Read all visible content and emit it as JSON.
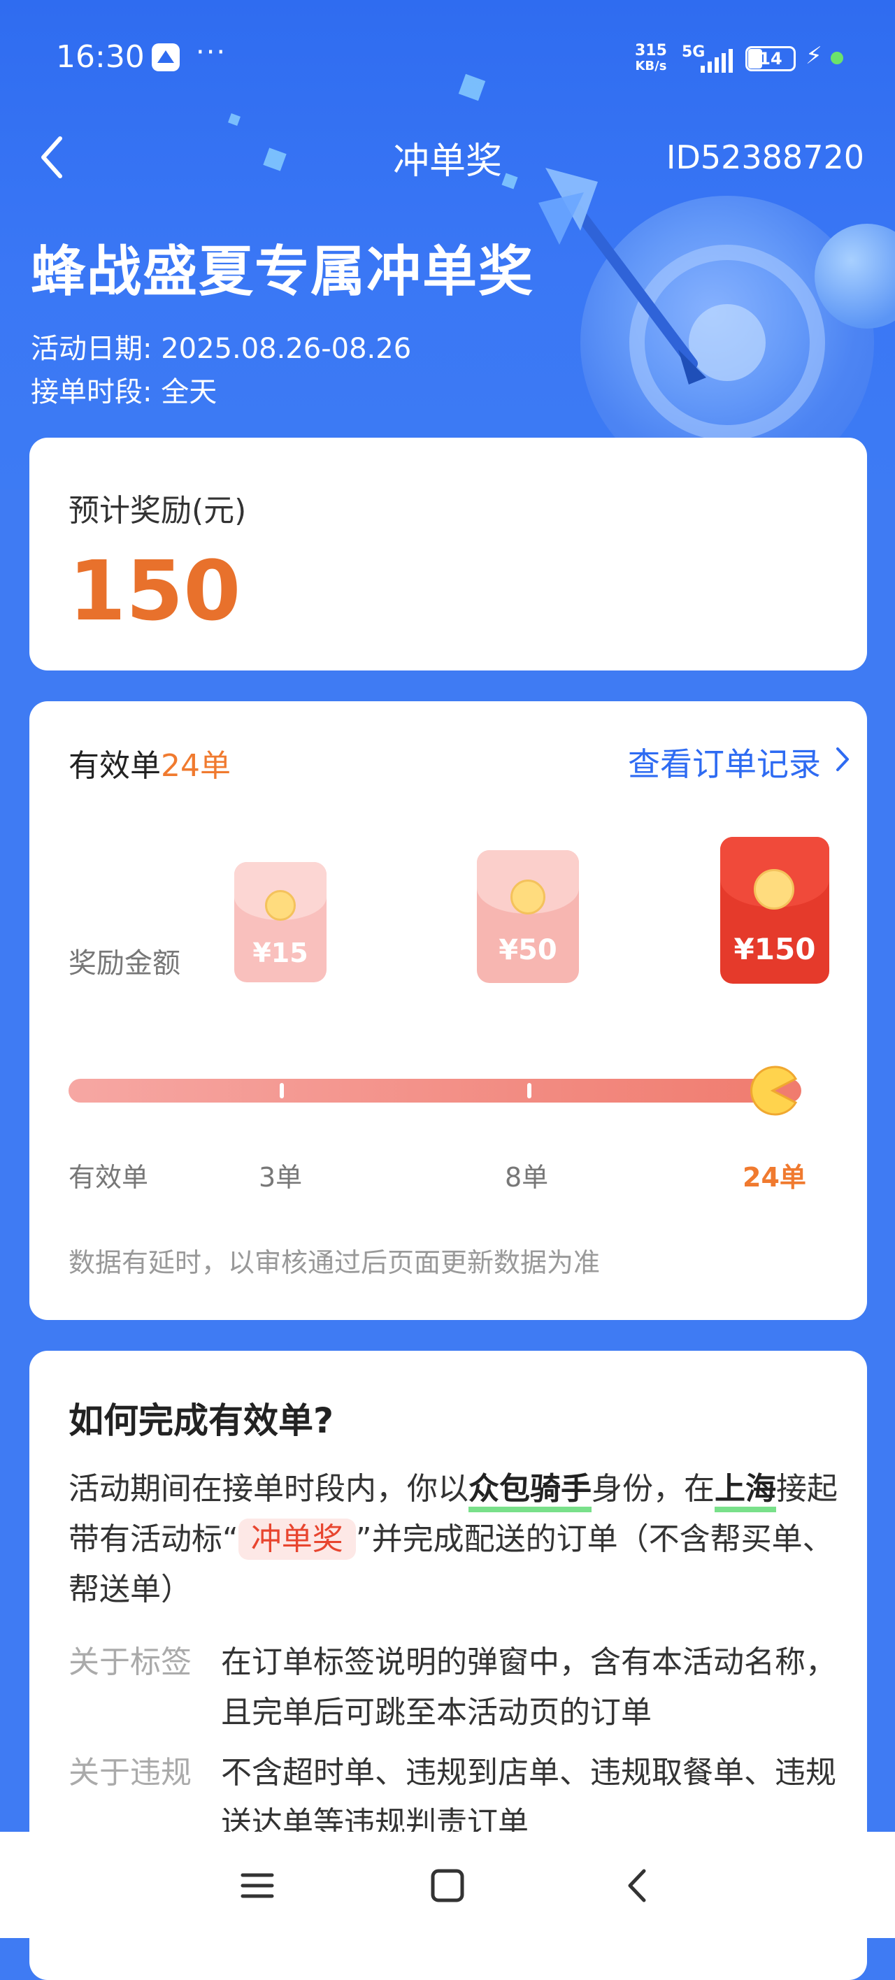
{
  "status_bar": {
    "time": "16:30",
    "more": "···",
    "speed_value": "315",
    "speed_unit": "KB/s",
    "signal_label": "5G",
    "battery": "14"
  },
  "nav": {
    "title": "冲单奖",
    "id": "ID52388720"
  },
  "hero": {
    "headline": "蜂战盛夏专属冲单奖",
    "date_line": "活动日期: 2025.08.26-08.26",
    "time_line": "接单时段: 全天"
  },
  "reward_card": {
    "label": "预计奖励(元)",
    "amount": "150"
  },
  "progress_card": {
    "valid_prefix": "有效单",
    "valid_count": "24单",
    "records_link": "查看订单记录",
    "reward_label": "奖励金额",
    "envelopes": [
      {
        "amount": "¥15"
      },
      {
        "amount": "¥50"
      },
      {
        "amount": "¥150"
      }
    ],
    "scale_label": "有效单",
    "milestones": [
      "3单",
      "8单",
      "24单"
    ],
    "progress_fraction": 1.0,
    "note": "数据有延时，以审核通过后页面更新数据为准"
  },
  "howto_card": {
    "title": "如何完成有效单?",
    "p1_a": "活动期间在接单时段内，你以",
    "p1_hl1": "众包骑手",
    "p1_b": "身份，在",
    "p1_hl2": "上海",
    "p1_c": "接起带有活动标“",
    "p1_tag": "冲单奖",
    "p1_d": "”并完成配送的订单（不含帮买单、帮送单）",
    "rows": [
      {
        "key": "关于标签",
        "value": "在订单标签说明的弹窗中，含有本活动名称，且完单后可跳至本活动页的订单"
      },
      {
        "key": "关于违规",
        "value": "不含超时单、违规到店单、违规取餐单、违规送达单等违规判责订单"
      }
    ]
  },
  "colors": {
    "primary_blue": "#3f7bf3",
    "accent_orange": "#e8712c",
    "link_blue": "#2e6bf2",
    "highlight_green": "#79e08a"
  }
}
